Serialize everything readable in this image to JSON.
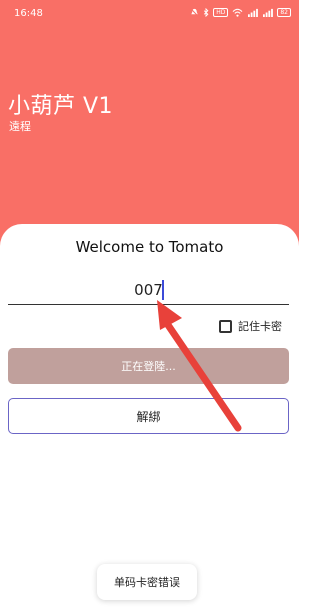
{
  "status_bar": {
    "time": "16:48",
    "icons": [
      "mute-icon",
      "bluetooth-icon",
      "hd-icon",
      "wifi-icon",
      "signal-icon",
      "signal-icon-2",
      "battery-icon"
    ],
    "hd_label": "HD",
    "battery_label": "82"
  },
  "header": {
    "title": "小葫芦 V1",
    "subtitle": "遠程"
  },
  "login": {
    "welcome": "Welcome to Tomato",
    "code_value": "007",
    "remember_label": "記住卡密",
    "remember_checked": false,
    "login_label": "正在登陸...",
    "unbind_label": "解綁"
  },
  "toast": {
    "message": "单码卡密错误"
  },
  "colors": {
    "header_bg": "#f96f66",
    "login_button_bg": "#c0a09c",
    "unbind_border": "#6b65c6",
    "annotation_arrow": "#e8413a"
  }
}
